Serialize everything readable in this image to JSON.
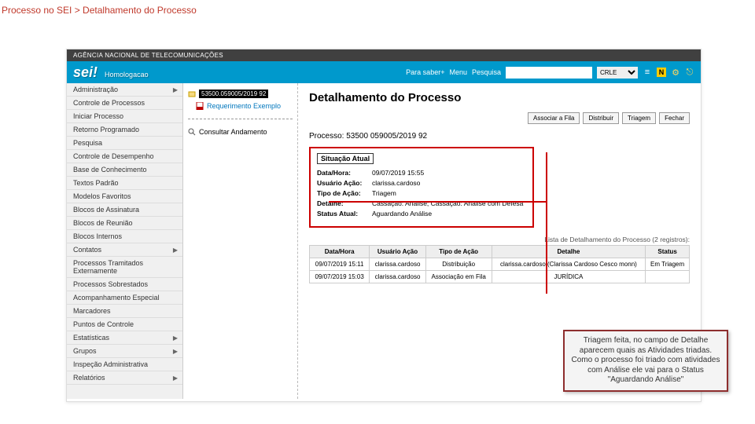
{
  "breadcrumb": "Processo no SEI > Detalhamento do Processo",
  "header": {
    "agency": "AGÊNCIA NACIONAL DE TELECOMUNICAÇÕES",
    "logo": "sei!",
    "env": "Homologacao",
    "para_saber": "Para saber+",
    "menu": "Menu",
    "pesquisa": "Pesquisa",
    "unit": "CRLE"
  },
  "sidebar": {
    "items": [
      {
        "label": "Administração",
        "arrow": true
      },
      {
        "label": "Controle de Processos",
        "arrow": false
      },
      {
        "label": "Iniciar Processo",
        "arrow": false
      },
      {
        "label": "Retorno Programado",
        "arrow": false
      },
      {
        "label": "Pesquisa",
        "arrow": false
      },
      {
        "label": "Controle de Desempenho",
        "arrow": false
      },
      {
        "label": "Base de Conhecimento",
        "arrow": false
      },
      {
        "label": "Textos Padrão",
        "arrow": false
      },
      {
        "label": "Modelos Favoritos",
        "arrow": false
      },
      {
        "label": "Blocos de Assinatura",
        "arrow": false
      },
      {
        "label": "Blocos de Reunião",
        "arrow": false
      },
      {
        "label": "Blocos Internos",
        "arrow": false
      },
      {
        "label": "Contatos",
        "arrow": true
      },
      {
        "label": "Processos Tramitados Externamente",
        "arrow": false
      },
      {
        "label": "Processos Sobrestados",
        "arrow": false
      },
      {
        "label": "Acompanhamento Especial",
        "arrow": false
      },
      {
        "label": "Marcadores",
        "arrow": false
      },
      {
        "label": "Puntos de Controle",
        "arrow": false
      },
      {
        "label": "Estatísticas",
        "arrow": true
      },
      {
        "label": "Grupos",
        "arrow": true
      },
      {
        "label": "Inspeção Administrativa",
        "arrow": false
      },
      {
        "label": "Relatórios",
        "arrow": true
      }
    ]
  },
  "tree": {
    "proc_num": "53500.059005/2019 92",
    "doc": "Requerimento Exemplo",
    "consult": "Consultar Andamento"
  },
  "content": {
    "title": "Detalhamento do Processo",
    "buttons": {
      "assoc": "Associar a Fila",
      "distrib": "Distribuir",
      "triagem": "Triagem",
      "fechar": "Fechar"
    },
    "proc_label": "Processo: 53500 059005/2019 92",
    "situacao_title": "Situação Atual",
    "situacao": {
      "datahora_k": "Data/Hora:",
      "datahora_v": "09/07/2019 15:55",
      "usuario_k": "Usuário Ação:",
      "usuario_v": "clarissa.cardoso",
      "tipo_k": "Tipo de Ação:",
      "tipo_v": "Triagem",
      "detalhe_k": "Detalhe:",
      "detalhe_v": "Cassação: Análise; Cassação: Análise com Defesa",
      "status_k": "Status Atual:",
      "status_v": "Aguardando Análise"
    },
    "list_label": "Lista de Detalhamento do Processo (2 registros):",
    "table_headers": {
      "c1": "Data/Hora",
      "c2": "Usuário Ação",
      "c3": "Tipo de Ação",
      "c4": "Detalhe",
      "c5": "Status"
    },
    "rows": [
      {
        "c1": "09/07/2019 15:11",
        "c2": "clarissa.cardoso",
        "c3": "Distribuição",
        "c4": "clarissa.cardoso (Clarissa Cardoso Cesco monn)",
        "c5": "Em Triagem"
      },
      {
        "c1": "09/07/2019 15:03",
        "c2": "clarissa.cardoso",
        "c3": "Associação em Fila",
        "c4": "JURÍDICA",
        "c5": ""
      }
    ]
  },
  "callout": "Triagem feita, no campo de Detalhe aparecem quais as Atividades triadas. Como o processo foi triado com atividades com Análise ele vai para o Status \"Aguardando Análise\""
}
